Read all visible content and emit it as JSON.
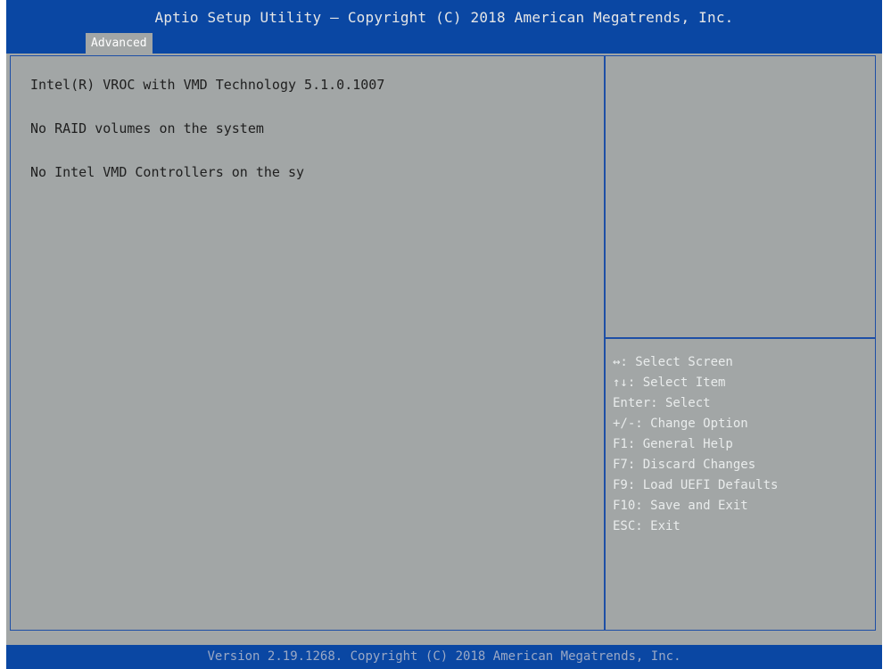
{
  "header": {
    "title": "Aptio Setup Utility – Copyright (C) 2018 American Megatrends, Inc.",
    "tab": "Advanced"
  },
  "main": {
    "lines": [
      "Intel(R) VROC with VMD Technology 5.1.0.1007",
      "No RAID volumes on the system",
      "No Intel VMD Controllers on the sy"
    ]
  },
  "help": {
    "items": [
      "↔: Select Screen",
      "↑↓: Select Item",
      "Enter: Select",
      "+/-: Change Option",
      "F1: General Help",
      "F7: Discard Changes",
      "F9: Load UEFI Defaults",
      "F10: Save and Exit",
      "ESC: Exit"
    ]
  },
  "footer": {
    "text": "Version 2.19.1268. Copyright (C) 2018 American Megatrends, Inc."
  },
  "colors": {
    "header_bg": "#0a47a3",
    "body_bg": "#a2a6a6",
    "border": "#1e4fa6",
    "help_text": "#e9ecec"
  }
}
